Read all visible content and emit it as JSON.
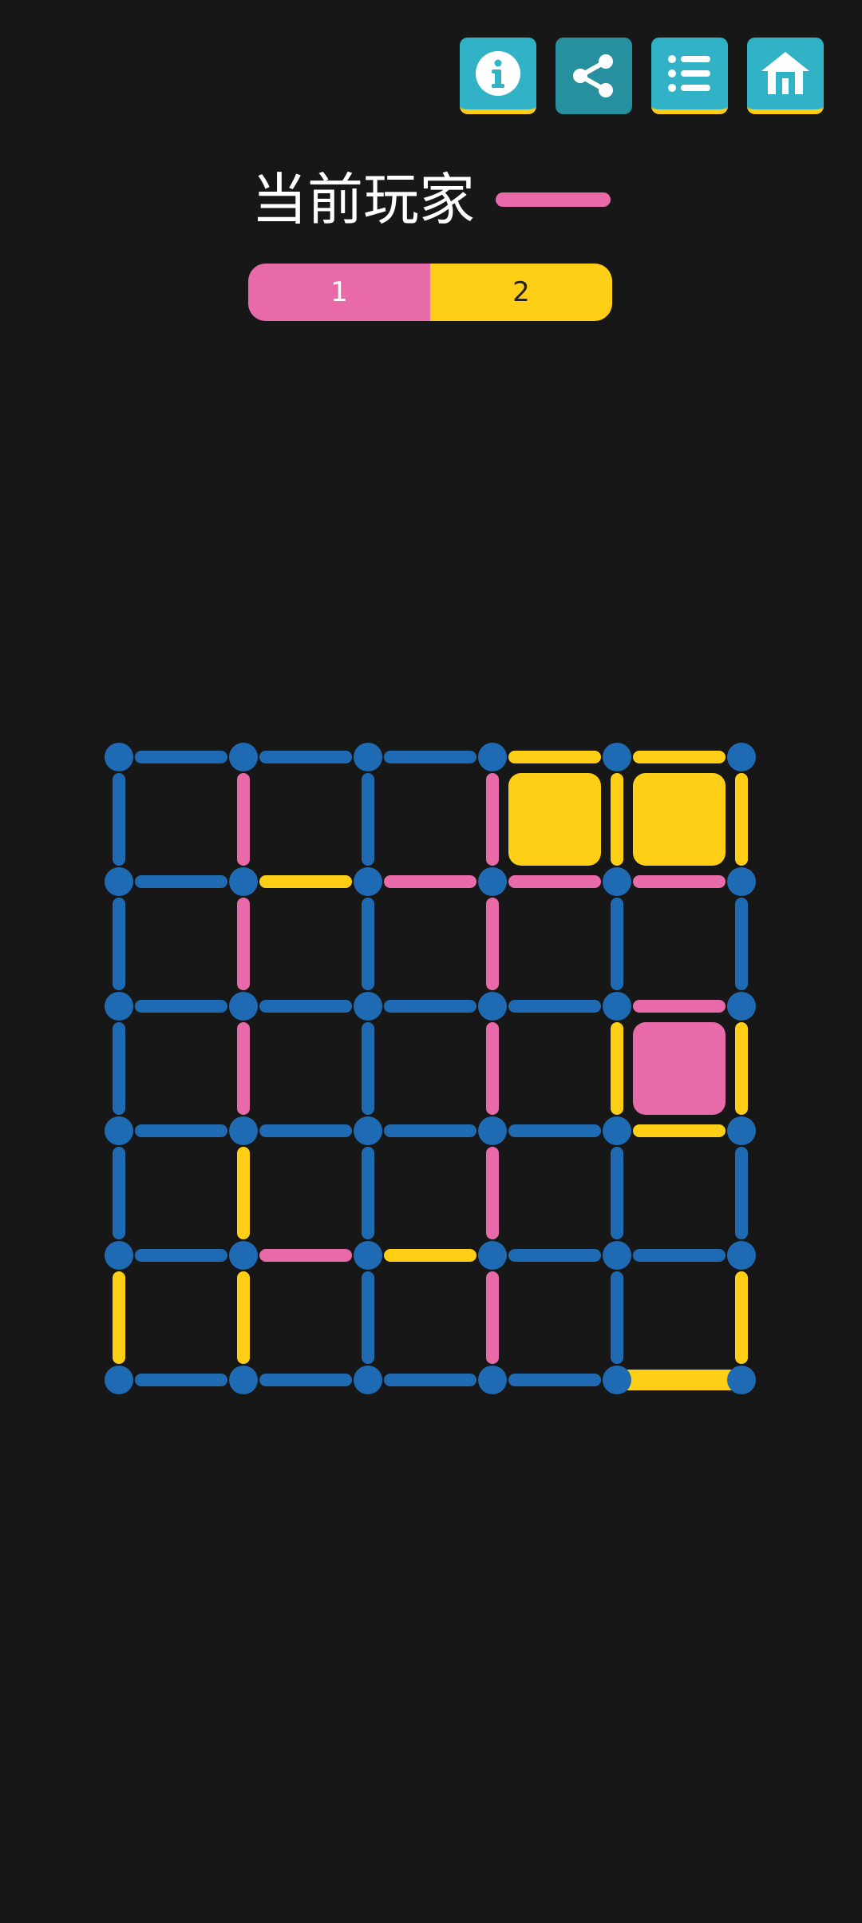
{
  "toolbar": {
    "buttons": [
      {
        "name": "info-button",
        "icon": "info-icon",
        "pressed": false
      },
      {
        "name": "share-button",
        "icon": "share-icon",
        "pressed": true
      },
      {
        "name": "list-button",
        "icon": "list-icon",
        "pressed": false
      },
      {
        "name": "home-button",
        "icon": "home-icon",
        "pressed": false
      }
    ]
  },
  "status": {
    "current_player_label": "当前玩家",
    "current_player": "pink"
  },
  "score": {
    "pink": "1",
    "yellow": "2",
    "pink_share": 0.5
  },
  "colors": {
    "background": "#171717",
    "button": "#31b2c6",
    "button_pressed": "#26909f",
    "button_accent": "#ffcc17",
    "neutral": "#1f6bb3",
    "pink": "#e96aa9",
    "yellow": "#ffcf17"
  },
  "board": {
    "size": 5,
    "horizontal_edges": [
      [
        "neutral",
        "neutral",
        "neutral",
        "yellow",
        "yellow"
      ],
      [
        "neutral",
        "yellow",
        "pink",
        "pink",
        "pink"
      ],
      [
        "neutral",
        "neutral",
        "neutral",
        "neutral",
        "pink"
      ],
      [
        "neutral",
        "neutral",
        "neutral",
        "neutral",
        "yellow"
      ],
      [
        "neutral",
        "pink",
        "yellow",
        "neutral",
        "neutral"
      ],
      [
        "neutral",
        "neutral",
        "neutral",
        "neutral",
        "yellow"
      ]
    ],
    "vertical_edges": [
      [
        "neutral",
        "pink",
        "neutral",
        "pink",
        "yellow",
        "yellow"
      ],
      [
        "neutral",
        "pink",
        "neutral",
        "pink",
        "neutral",
        "neutral"
      ],
      [
        "neutral",
        "pink",
        "neutral",
        "pink",
        "yellow",
        "yellow"
      ],
      [
        "neutral",
        "yellow",
        "neutral",
        "pink",
        "neutral",
        "neutral"
      ],
      [
        "yellow",
        "yellow",
        "neutral",
        "pink",
        "neutral",
        "yellow"
      ]
    ],
    "cells": [
      [
        null,
        null,
        null,
        "yellow",
        "yellow"
      ],
      [
        null,
        null,
        null,
        null,
        null
      ],
      [
        null,
        null,
        null,
        null,
        "pink"
      ],
      [
        null,
        null,
        null,
        null,
        null
      ],
      [
        null,
        null,
        null,
        null,
        null
      ]
    ]
  }
}
